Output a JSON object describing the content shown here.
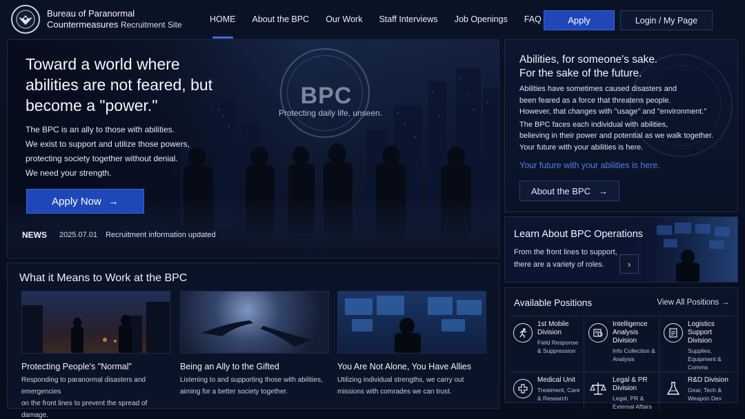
{
  "header": {
    "title_line1": "Bureau of Paranormal",
    "title_line2": "Countermeasures",
    "title_suffix": "Recruitment Site",
    "nav": [
      "HOME",
      "About the BPC",
      "Our Work",
      "Staff Interviews",
      "Job Openings",
      "FAQ"
    ],
    "apply_label": "Apply",
    "login_label": "Login / My Page",
    "accent_color": "#1f47b8"
  },
  "hero": {
    "seal_text": "BPC",
    "tagline": "Protecting daily life, unseen.",
    "title": "Toward a world where abilities are not feared, but become a \"power.\"",
    "body": [
      "The BPC is an ally to those with abilities.",
      "We exist to support and utilize those powers,",
      "protecting society together without denial.",
      "We need your strength."
    ],
    "cta_label": "Apply Now",
    "news_label": "NEWS",
    "news_date": "2025.07.01",
    "news_text": "Recruitment information updated"
  },
  "about": {
    "title_line1": "Abilities, for someone's sake.",
    "title_line2": "For the sake of the future.",
    "para1": [
      "Abilities have sometimes caused disasters and",
      "been feared as a force that threatens people.",
      "However, that changes with \"usage\" and \"environment.\""
    ],
    "para2": [
      "The BPC faces each individual with abilities,",
      "believing in their power and potential as we walk together.",
      "Your future with your abilities is here."
    ],
    "highlight": "Your future with your abilities is here.",
    "button_label": "About the BPC"
  },
  "operations": {
    "title": "Learn About BPC Operations",
    "body": [
      "From the front lines to support,",
      "there are a variety of roles."
    ]
  },
  "positions": {
    "title": "Available Positions",
    "view_all": "View All Positions",
    "items": [
      {
        "name": "1st Mobile Division",
        "desc": "Field Response & Suppression",
        "icon": "runner-icon"
      },
      {
        "name": "Intelligence Analysis Division",
        "desc": "Info Collection & Analysis",
        "icon": "analysis-icon"
      },
      {
        "name": "Logistics Support Division",
        "desc": "Supplies, Equipment & Comms",
        "icon": "clipboard-icon"
      },
      {
        "name": "Medical Unit",
        "desc": "Treatment, Care & Research",
        "icon": "medical-cross-icon"
      },
      {
        "name": "Legal & PR Division",
        "desc": "Legal, PR & External Affairs",
        "icon": "scales-icon"
      },
      {
        "name": "R&D Division",
        "desc": "Gear, Tech & Weapon Dev",
        "icon": "flask-icon"
      }
    ]
  },
  "work": {
    "title": "What it Means to Work at the BPC",
    "cards": [
      {
        "title": "Protecting People's \"Normal\"",
        "body": [
          "Responding to paranormal disasters and emergencies",
          "on the front lines to prevent the spread of damage."
        ]
      },
      {
        "title": "Being an Ally to the Gifted",
        "body": [
          "Listening to and supporting those with abilities,",
          "aiming for a better society together."
        ]
      },
      {
        "title": "You Are Not Alone, You Have Allies",
        "body": [
          "Utilizing individual strengths, we carry out",
          "missions with comrades we can trust."
        ]
      }
    ]
  }
}
